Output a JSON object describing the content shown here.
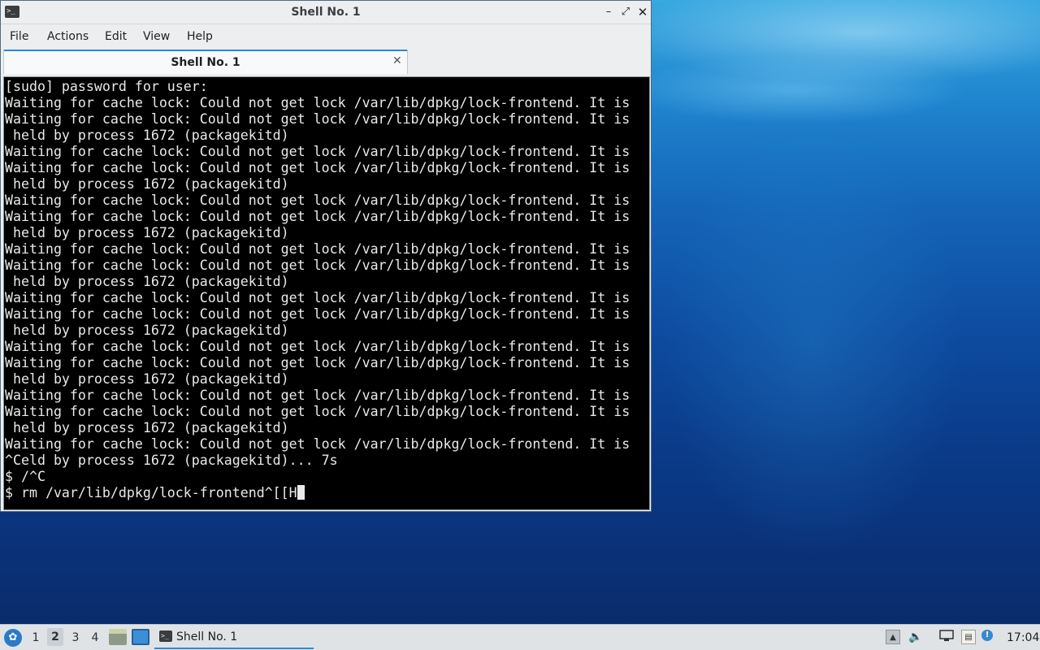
{
  "window": {
    "title": "Shell No. 1",
    "icon": "terminal-icon",
    "controls": {
      "minimize": "–",
      "maximize": "⤢",
      "close": "✕"
    }
  },
  "menubar": {
    "items": [
      "File",
      "Actions",
      "Edit",
      "View",
      "Help"
    ]
  },
  "tab": {
    "label": "Shell No. 1",
    "close": "✕"
  },
  "terminal": {
    "lines": [
      "[sudo] password for user:",
      "Waiting for cache lock: Could not get lock /var/lib/dpkg/lock-frontend. It is",
      "Waiting for cache lock: Could not get lock /var/lib/dpkg/lock-frontend. It is",
      " held by process 1672 (packagekitd)",
      "Waiting for cache lock: Could not get lock /var/lib/dpkg/lock-frontend. It is",
      "Waiting for cache lock: Could not get lock /var/lib/dpkg/lock-frontend. It is",
      " held by process 1672 (packagekitd)",
      "Waiting for cache lock: Could not get lock /var/lib/dpkg/lock-frontend. It is",
      "Waiting for cache lock: Could not get lock /var/lib/dpkg/lock-frontend. It is",
      " held by process 1672 (packagekitd)",
      "Waiting for cache lock: Could not get lock /var/lib/dpkg/lock-frontend. It is",
      "Waiting for cache lock: Could not get lock /var/lib/dpkg/lock-frontend. It is",
      " held by process 1672 (packagekitd)",
      "Waiting for cache lock: Could not get lock /var/lib/dpkg/lock-frontend. It is",
      "Waiting for cache lock: Could not get lock /var/lib/dpkg/lock-frontend. It is",
      " held by process 1672 (packagekitd)",
      "Waiting for cache lock: Could not get lock /var/lib/dpkg/lock-frontend. It is",
      "Waiting for cache lock: Could not get lock /var/lib/dpkg/lock-frontend. It is",
      " held by process 1672 (packagekitd)",
      "Waiting for cache lock: Could not get lock /var/lib/dpkg/lock-frontend. It is",
      "Waiting for cache lock: Could not get lock /var/lib/dpkg/lock-frontend. It is",
      " held by process 1672 (packagekitd)",
      "Waiting for cache lock: Could not get lock /var/lib/dpkg/lock-frontend. It is",
      "^Celd by process 1672 (packagekitd)... 7s",
      "$ /^C"
    ],
    "prompt_line": "$ rm /var/lib/dpkg/lock-frontend^[[H"
  },
  "taskbar": {
    "start_icon": "lxqt-menu-icon",
    "desktops": [
      "1",
      "2",
      "3",
      "4"
    ],
    "active_desktop": "2",
    "quicklaunch": [
      "file-manager-icon",
      "show-desktop-icon"
    ],
    "task": {
      "label": "Shell No. 1",
      "icon": "terminal-icon"
    },
    "tray": [
      "show-hidden-icon",
      "volume-icon",
      "network-icon",
      "clipboard-icon",
      "update-notifier-icon"
    ],
    "clock": "17:04"
  },
  "colors": {
    "accent": "#2a8ad8",
    "terminal_bg": "#000000",
    "terminal_fg": "#e9e9e9"
  }
}
